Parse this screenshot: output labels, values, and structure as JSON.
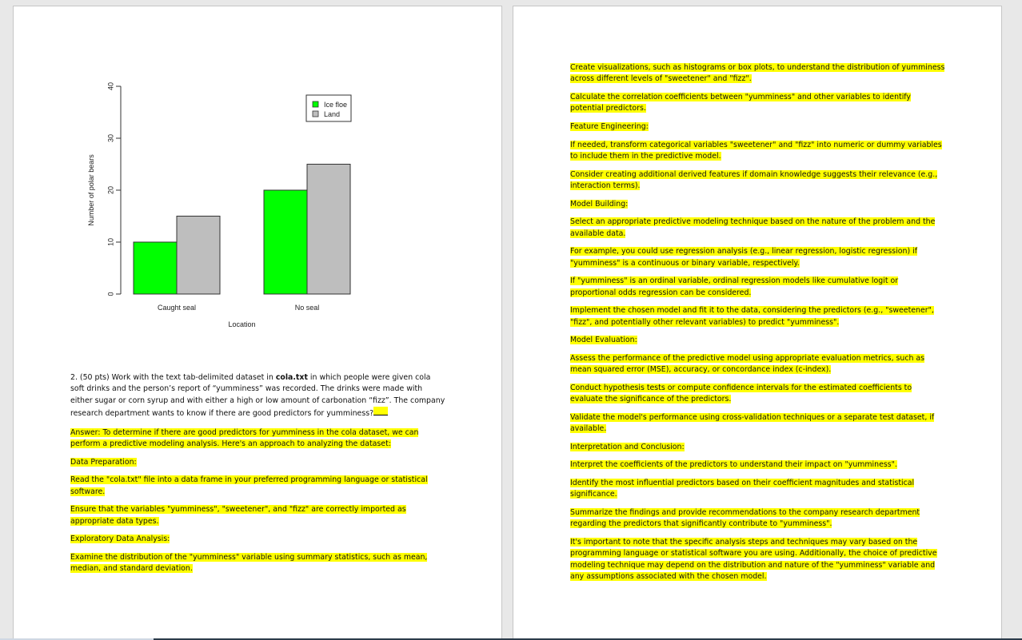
{
  "chart_data": {
    "type": "bar",
    "categories": [
      "Caught seal",
      "No seal"
    ],
    "series": [
      {
        "name": "Ice floe",
        "values": [
          10,
          20
        ],
        "color": "#00ff00"
      },
      {
        "name": "Land",
        "values": [
          15,
          25
        ],
        "color": "#bebebe"
      }
    ],
    "xlabel": "Location",
    "ylabel": "Number of polar bears",
    "ylim": [
      0,
      40
    ],
    "yticks": [
      "0",
      "10",
      "20",
      "30",
      "40"
    ],
    "legend_position": "top-right"
  },
  "question": {
    "prefix": "2.  (50 pts) Work with the text tab-delimited dataset in ",
    "filename": "cola.txt",
    "suffix": " in which people were given cola soft drinks and the person’s report of “yumminess” was recorded. The drinks were made with either sugar or corn syrup and with either a high or low amount of carbonation “fizz”. The company research department wants to know if there are good predictors for yumminess?"
  },
  "left_answer": [
    "Answer: To determine if there are good predictors for yumminess in the cola dataset, we can perform a predictive modeling analysis. Here's an approach to analyzing the dataset:",
    "Data Preparation:",
    "Read the \"cola.txt\" file into a data frame in your preferred programming language or statistical software.",
    "Ensure that the variables \"yumminess\", \"sweetener\", and \"fizz\" are correctly imported as appropriate data types.",
    "Exploratory Data Analysis:",
    "Examine the distribution of the \"yumminess\" variable using summary statistics, such as mean, median, and standard deviation."
  ],
  "right_answer": [
    "Create visualizations, such as histograms or box plots, to understand the distribution of yumminess across different levels of \"sweetener\" and \"fizz\".",
    "Calculate the correlation coefficients between \"yumminess\" and other variables to identify potential predictors.",
    "Feature Engineering:",
    "If needed, transform categorical variables \"sweetener\" and \"fizz\" into numeric or dummy variables to include them in the predictive model.",
    "Consider creating additional derived features if domain knowledge suggests their relevance (e.g., interaction terms).",
    "Model Building:",
    "Select an appropriate predictive modeling technique based on the nature of the problem and the available data.",
    "For example, you could use regression analysis (e.g., linear regression, logistic regression) if \"yumminess\" is a continuous or binary variable, respectively.",
    "If \"yumminess\" is an ordinal variable, ordinal regression models like cumulative logit or proportional odds regression can be considered.",
    "Implement the chosen model and fit it to the data, considering the predictors (e.g., \"sweetener\", \"fizz\", and potentially other relevant variables) to predict \"yumminess\".",
    "Model Evaluation:",
    "Assess the performance of the predictive model using appropriate evaluation metrics, such as mean squared error (MSE), accuracy, or concordance index (c-index).",
    "Conduct hypothesis tests or compute confidence intervals for the estimated coefficients to evaluate the significance of the predictors.",
    "Validate the model's performance using cross-validation techniques or a separate test dataset, if available.",
    "Interpretation and Conclusion:",
    "Interpret the coefficients of the predictors to understand their impact on \"yumminess\".",
    "Identify the most influential predictors based on their coefficient magnitudes and statistical significance.",
    "Summarize the findings and provide recommendations to the company research department regarding the predictors that significantly contribute to \"yumminess\".",
    "It's important to note that the specific analysis steps and techniques may vary based on the programming language or statistical software you are using. Additionally, the choice of predictive modeling technique may depend on the distribution and nature of the \"yumminess\" variable and any assumptions associated with the chosen model."
  ]
}
